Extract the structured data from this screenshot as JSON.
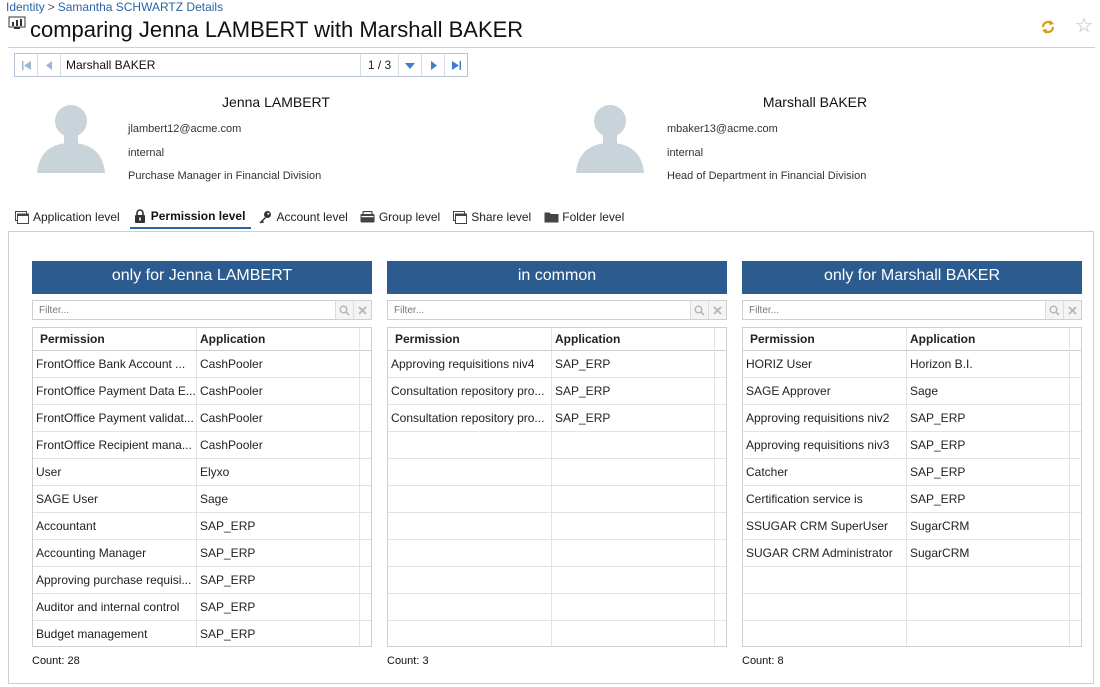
{
  "breadcrumb": {
    "root": "Identity",
    "separator": ">",
    "current": "Samantha SCHWARTZ Details"
  },
  "page": {
    "title": "comparing Jenna LAMBERT with Marshall BAKER"
  },
  "navigator": {
    "value": "Marshall BAKER",
    "counter": "1 / 3"
  },
  "people": [
    {
      "name": "Jenna LAMBERT",
      "email": "jlambert12@acme.com",
      "type": "internal",
      "role": "Purchase Manager in Financial Division"
    },
    {
      "name": "Marshall BAKER",
      "email": "mbaker13@acme.com",
      "type": "internal",
      "role": "Head of Department in Financial Division"
    }
  ],
  "tabs": [
    {
      "label": "Application level",
      "icon": "window-icon"
    },
    {
      "label": "Permission level",
      "icon": "lock-icon",
      "active": true
    },
    {
      "label": "Account level",
      "icon": "key-icon"
    },
    {
      "label": "Group level",
      "icon": "group-icon"
    },
    {
      "label": "Share level",
      "icon": "share-icon"
    },
    {
      "label": "Folder level",
      "icon": "folder-icon"
    }
  ],
  "columns_header": {
    "permission": "Permission",
    "application": "Application"
  },
  "filter_placeholder": "Filter...",
  "panels": [
    {
      "title": "only for Jenna LAMBERT",
      "count_label": "Count: 28",
      "rows": [
        [
          "FrontOffice Bank Account ...",
          "CashPooler"
        ],
        [
          "FrontOffice Payment Data E...",
          "CashPooler"
        ],
        [
          "FrontOffice Payment validat...",
          "CashPooler"
        ],
        [
          "FrontOffice Recipient mana...",
          "CashPooler"
        ],
        [
          "User",
          "Elyxo"
        ],
        [
          "SAGE User",
          "Sage"
        ],
        [
          "Accountant",
          "SAP_ERP"
        ],
        [
          "Accounting Manager",
          "SAP_ERP"
        ],
        [
          "Approving purchase requisi...",
          "SAP_ERP"
        ],
        [
          "Auditor and internal control",
          "SAP_ERP"
        ],
        [
          "Budget management",
          "SAP_ERP"
        ]
      ]
    },
    {
      "title": "in common",
      "count_label": "Count: 3",
      "rows": [
        [
          "Approving requisitions niv4",
          "SAP_ERP"
        ],
        [
          "Consultation repository pro...",
          "SAP_ERP"
        ],
        [
          "Consultation repository pro...",
          "SAP_ERP"
        ]
      ]
    },
    {
      "title": "only for Marshall BAKER",
      "count_label": "Count: 8",
      "rows": [
        [
          "HORIZ User",
          "Horizon B.I."
        ],
        [
          "SAGE Approver",
          "Sage"
        ],
        [
          "Approving requisitions niv2",
          "SAP_ERP"
        ],
        [
          "Approving requisitions niv3",
          "SAP_ERP"
        ],
        [
          "Catcher",
          "SAP_ERP"
        ],
        [
          "Certification service is",
          "SAP_ERP"
        ],
        [
          "SSUGAR CRM SuperUser",
          "SugarCRM"
        ],
        [
          "SUGAR CRM Administrator",
          "SugarCRM"
        ]
      ]
    }
  ],
  "colors": {
    "accent": "#2c5c8f",
    "link": "#2a64a8",
    "tab_underline": "#2a64a8"
  }
}
